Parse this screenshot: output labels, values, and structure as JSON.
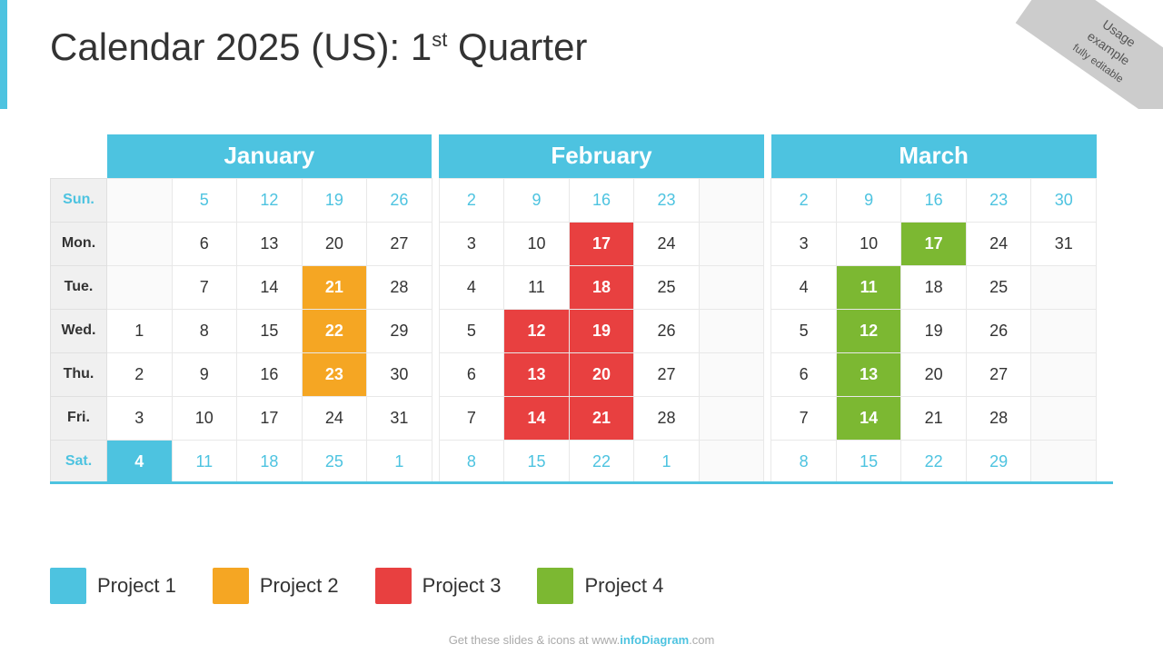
{
  "title": "Calendar 2025 (US): 1",
  "title_sup": "st",
  "title_suffix": " Quarter",
  "corner_ribbon": [
    "Usage",
    "example",
    "fully editable"
  ],
  "months": [
    "January",
    "February",
    "March"
  ],
  "day_labels": [
    "Sun.",
    "Mon.",
    "Tue.",
    "Wed.",
    "Thu.",
    "Fri.",
    "Sat."
  ],
  "legend": [
    {
      "label": "Project 1",
      "color": "#4dc3e0"
    },
    {
      "label": "Project 2",
      "color": "#f5a623"
    },
    {
      "label": "Project 3",
      "color": "#e84040"
    },
    {
      "label": "Project 4",
      "color": "#7cb832"
    }
  ],
  "footer": "Get these slides & icons at www.infoDiagram.com",
  "calendar": {
    "january": {
      "weeks": [
        [
          "",
          "",
          "",
          "1",
          "2",
          "3",
          "4"
        ],
        [
          "5",
          "6",
          "7",
          "8",
          "9",
          "10",
          "11"
        ],
        [
          "12",
          "13",
          "14",
          "15",
          "16",
          "17",
          "18"
        ],
        [
          "19",
          "20",
          "21",
          "22",
          "23",
          "24",
          "25"
        ],
        [
          "26",
          "27",
          "28",
          "29",
          "30",
          "31",
          ""
        ]
      ]
    },
    "february": {
      "weeks": [
        [
          "2",
          "3",
          "4",
          "5",
          "6",
          "7",
          "8"
        ],
        [
          "9",
          "10",
          "11",
          "12",
          "13",
          "14",
          "15"
        ],
        [
          "16",
          "17",
          "18",
          "19",
          "20",
          "21",
          "22"
        ],
        [
          "23",
          "24",
          "25",
          "26",
          "27",
          "28",
          "1"
        ]
      ]
    },
    "march": {
      "weeks": [
        [
          "2",
          "3",
          "4",
          "5",
          "6",
          "7",
          "8"
        ],
        [
          "9",
          "10",
          "11",
          "12",
          "13",
          "14",
          "15"
        ],
        [
          "16",
          "17",
          "18",
          "19",
          "20",
          "21",
          "22"
        ],
        [
          "23",
          "24",
          "25",
          "26",
          "27",
          "28",
          "29"
        ],
        [
          "30",
          "31",
          "",
          "",
          "",
          "",
          ""
        ]
      ]
    }
  }
}
